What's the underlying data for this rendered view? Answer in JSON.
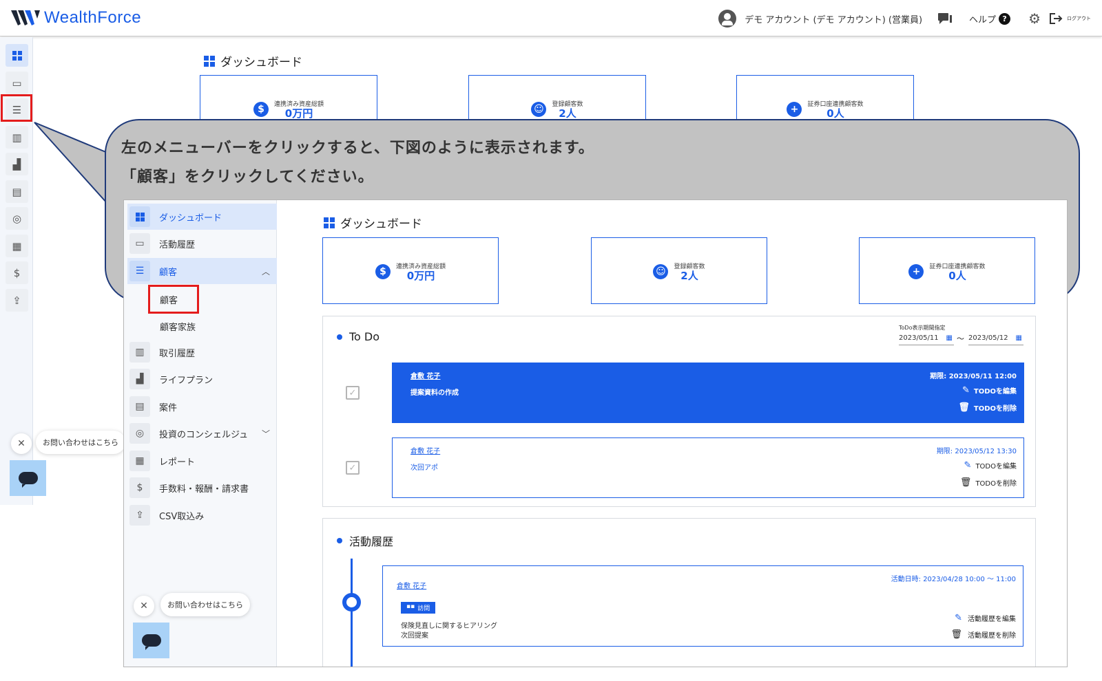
{
  "app": {
    "logo": "WealthForce"
  },
  "header": {
    "user": "デモ アカウント (デモ アカウント) (営業員)",
    "help": "ヘルプ",
    "logout": "ログアウト"
  },
  "page": {
    "title": "ダッシュボード"
  },
  "stats": [
    {
      "label": "連携済み資産総額",
      "value": "0万円"
    },
    {
      "label": "登録顧客数",
      "value": "2人"
    },
    {
      "label": "証券口座連携顧客数",
      "value": "0人"
    }
  ],
  "callout": {
    "line1": "左のメニューバーをクリックすると、下図のように表示されます。",
    "line2": "「顧客」をクリックしてください。"
  },
  "sidebar": {
    "items": [
      {
        "label": "ダッシュボード"
      },
      {
        "label": "活動履歴"
      },
      {
        "label": "顧客",
        "chevron": "^"
      },
      {
        "label": "取引履歴"
      },
      {
        "label": "ライフプラン"
      },
      {
        "label": "案件"
      },
      {
        "label": "投資のコンシェルジュ",
        "chevron": "v"
      },
      {
        "label": "レポート"
      },
      {
        "label": "手数料・報酬・請求書"
      },
      {
        "label": "CSV取込み"
      }
    ],
    "sub_items": [
      "顧客",
      "顧客家族"
    ]
  },
  "todo": {
    "title": "To Do",
    "period_label": "ToDo表示期間指定",
    "date_from": "2023/05/11",
    "date_sep": "〜",
    "date_to": "2023/05/12",
    "items": [
      {
        "name": "倉敷 花子",
        "desc": "提案資料の作成",
        "due": "期限: 2023/05/11 12:00",
        "edit": "TODOを編集",
        "delete": "TODOを削除"
      },
      {
        "name": "倉敷 花子",
        "desc": "次回アポ",
        "due": "期限: 2023/05/12 13:30",
        "edit": "TODOを編集",
        "delete": "TODOを削除"
      }
    ]
  },
  "activity": {
    "title": "活動履歴",
    "item": {
      "name": "倉敷 花子",
      "date": "活動日時: 2023/04/28 10:00 〜 11:00",
      "tag": "訪問",
      "line1": "保険見直しに関するヒアリング",
      "line2": "次回提案",
      "edit": "活動履歴を編集",
      "delete": "活動履歴を削除"
    }
  },
  "chat": {
    "prompt": "お問い合わせはこちら"
  },
  "colors": {
    "accent": "#1a5de6",
    "highlight": "#e41c1c",
    "callout": "#c2c2c2"
  }
}
